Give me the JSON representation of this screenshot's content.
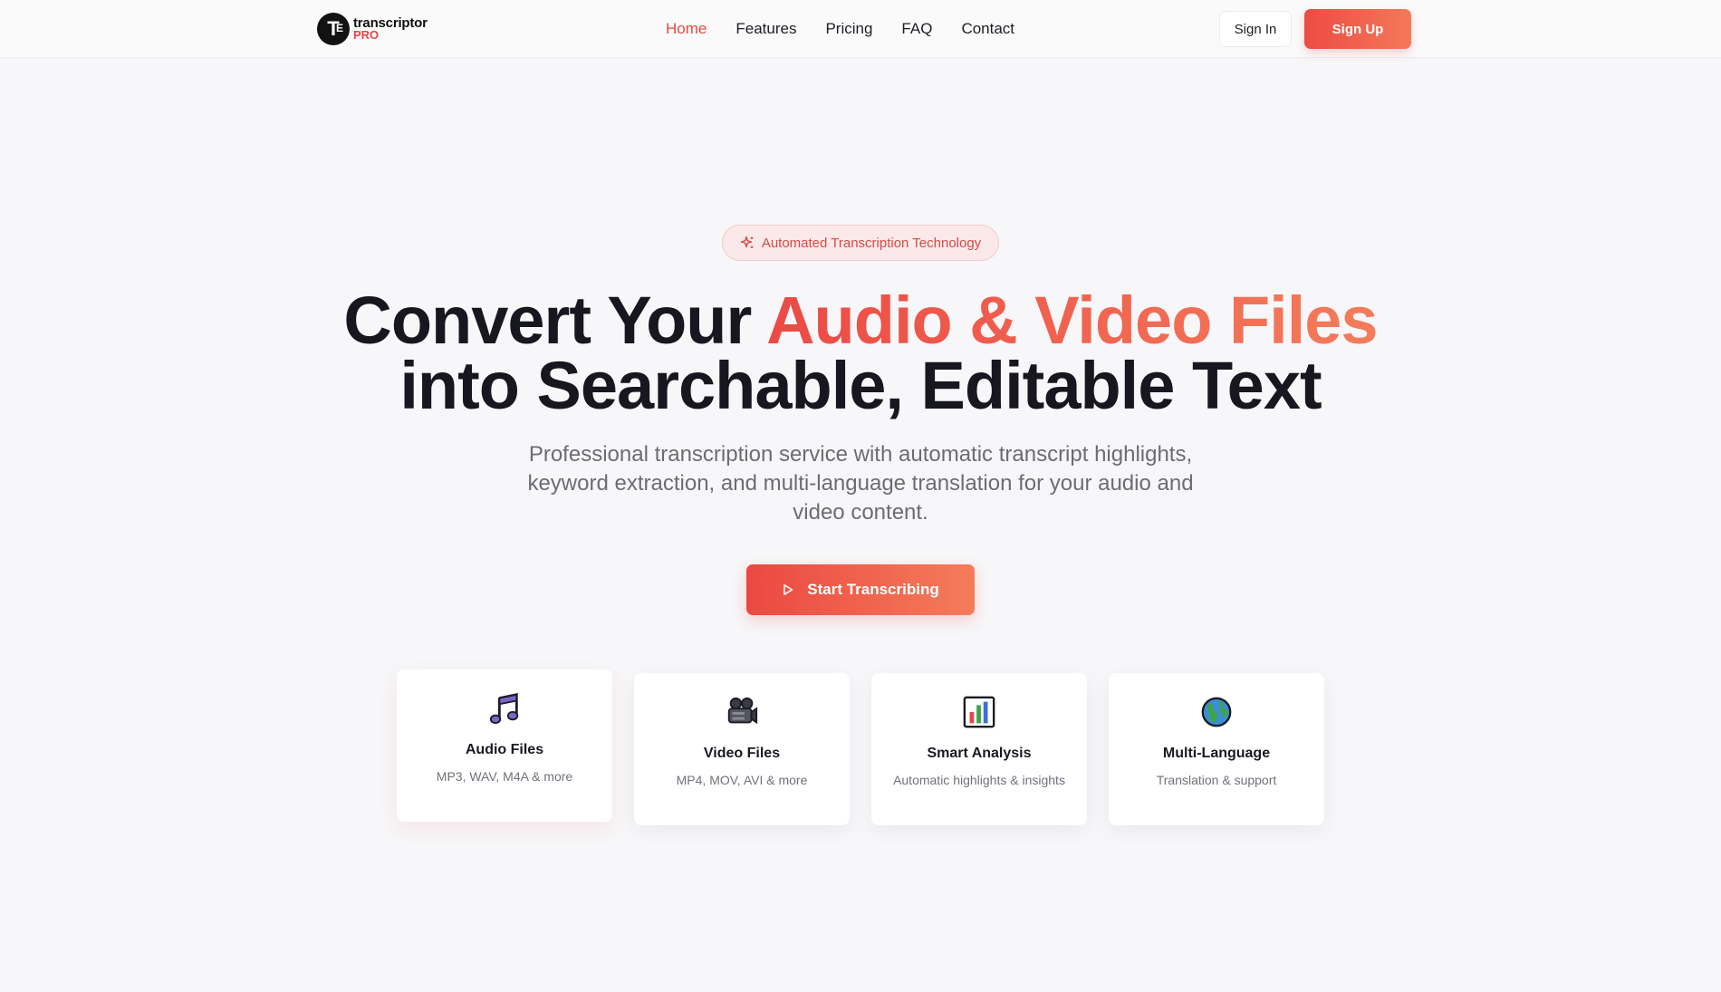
{
  "brand": {
    "mark": "T",
    "mark_sub": "E",
    "name": "transcriptor",
    "suffix": "PRO",
    "accent": "#e94545"
  },
  "nav": {
    "items": [
      {
        "label": "Home",
        "active": true
      },
      {
        "label": "Features",
        "active": false
      },
      {
        "label": "Pricing",
        "active": false
      },
      {
        "label": "FAQ",
        "active": false
      },
      {
        "label": "Contact",
        "active": false
      }
    ]
  },
  "auth": {
    "signin_label": "Sign In",
    "signup_label": "Sign Up"
  },
  "hero": {
    "badge": "Automated Transcription Technology",
    "badge_icon": "sparkle-icon",
    "headline_part1": "Convert Your ",
    "headline_highlight": "Audio & Video Files",
    "headline_line2": "into Searchable, Editable Text",
    "subtitle": "Professional transcription service with automatic transcript highlights, keyword extraction, and multi-language translation for your audio and video content.",
    "cta_label": "Start Transcribing",
    "cta_icon": "play-icon"
  },
  "features": [
    {
      "icon": "music-note-icon",
      "title": "Audio Files",
      "desc": "MP3, WAV, M4A & more"
    },
    {
      "icon": "video-camera-icon",
      "title": "Video Files",
      "desc": "MP4, MOV, AVI & more"
    },
    {
      "icon": "bar-chart-icon",
      "title": "Smart Analysis",
      "desc": "Automatic highlights & insights"
    },
    {
      "icon": "globe-icon",
      "title": "Multi-Language",
      "desc": "Translation & support"
    }
  ],
  "colors": {
    "gradient_start": "#ec4841",
    "gradient_end": "#f47c5b",
    "text_dark": "#17171f",
    "text_muted": "#6c6c76"
  }
}
